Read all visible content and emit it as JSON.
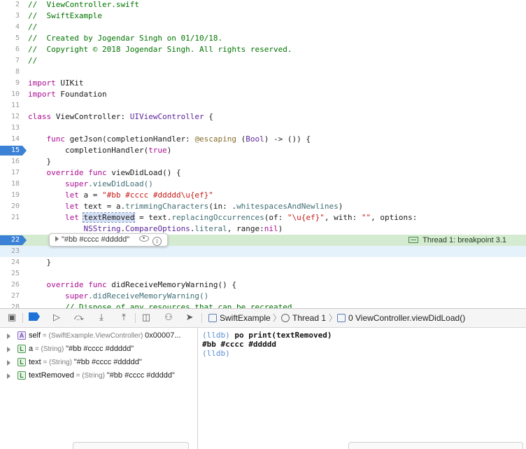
{
  "editor": {
    "lines": [
      {
        "num": "2",
        "segments": [
          {
            "t": "//  ViewController.swift",
            "c": "comment"
          }
        ]
      },
      {
        "num": "3",
        "segments": [
          {
            "t": "//  SwiftExample",
            "c": "comment"
          }
        ]
      },
      {
        "num": "4",
        "segments": [
          {
            "t": "//",
            "c": "comment"
          }
        ]
      },
      {
        "num": "5",
        "segments": [
          {
            "t": "//  Created by Jogendar Singh on 01/10/18.",
            "c": "comment"
          }
        ]
      },
      {
        "num": "6",
        "segments": [
          {
            "t": "//  Copyright © 2018 Jogendar Singh. All rights reserved.",
            "c": "comment"
          }
        ]
      },
      {
        "num": "7",
        "segments": [
          {
            "t": "//",
            "c": "comment"
          }
        ]
      },
      {
        "num": "8",
        "segments": []
      },
      {
        "num": "9",
        "segments": [
          {
            "t": "import",
            "c": "keyword"
          },
          {
            "t": " UIKit",
            "c": "plain"
          }
        ]
      },
      {
        "num": "10",
        "segments": [
          {
            "t": "import",
            "c": "keyword"
          },
          {
            "t": " Foundation",
            "c": "plain"
          }
        ]
      },
      {
        "num": "11",
        "segments": []
      },
      {
        "num": "12",
        "segments": [
          {
            "t": "class",
            "c": "keyword"
          },
          {
            "t": " ViewController: ",
            "c": "plain"
          },
          {
            "t": "UIViewController",
            "c": "type"
          },
          {
            "t": " {",
            "c": "plain"
          }
        ]
      },
      {
        "num": "13",
        "segments": []
      },
      {
        "num": "14",
        "segments": [
          {
            "t": "    ",
            "c": "plain"
          },
          {
            "t": "func",
            "c": "keyword"
          },
          {
            "t": " getJson(completionHandler: ",
            "c": "plain"
          },
          {
            "t": "@escaping",
            "c": "attr"
          },
          {
            "t": " (",
            "c": "plain"
          },
          {
            "t": "Bool",
            "c": "type"
          },
          {
            "t": ") -> ()) {",
            "c": "plain"
          }
        ]
      },
      {
        "num": "15",
        "breakpoint": true,
        "segments": [
          {
            "t": "        completionHandler(",
            "c": "plain"
          },
          {
            "t": "true",
            "c": "keyword"
          },
          {
            "t": ")",
            "c": "plain"
          }
        ]
      },
      {
        "num": "16",
        "segments": [
          {
            "t": "    }",
            "c": "plain"
          }
        ]
      },
      {
        "num": "17",
        "segments": [
          {
            "t": "    ",
            "c": "plain"
          },
          {
            "t": "override",
            "c": "keyword"
          },
          {
            "t": " ",
            "c": "plain"
          },
          {
            "t": "func",
            "c": "keyword"
          },
          {
            "t": " viewDidLoad() {",
            "c": "plain"
          }
        ]
      },
      {
        "num": "18",
        "segments": [
          {
            "t": "        ",
            "c": "plain"
          },
          {
            "t": "super",
            "c": "keyword"
          },
          {
            "t": ".viewDidLoad()",
            "c": "var"
          }
        ]
      },
      {
        "num": "19",
        "segments": [
          {
            "t": "        ",
            "c": "plain"
          },
          {
            "t": "let",
            "c": "keyword"
          },
          {
            "t": " a = ",
            "c": "plain"
          },
          {
            "t": "\"#bb #cccc #ddddd\\u{ef}\"",
            "c": "string"
          }
        ]
      },
      {
        "num": "20",
        "segments": [
          {
            "t": "        ",
            "c": "plain"
          },
          {
            "t": "let",
            "c": "keyword"
          },
          {
            "t": " text = a.",
            "c": "plain"
          },
          {
            "t": "trimmingCharacters",
            "c": "var"
          },
          {
            "t": "(in: .",
            "c": "plain"
          },
          {
            "t": "whitespacesAndNewlines",
            "c": "var"
          },
          {
            "t": ")",
            "c": "plain"
          }
        ]
      },
      {
        "num": "21",
        "segments": [
          {
            "t": "        ",
            "c": "plain"
          },
          {
            "t": "let",
            "c": "keyword"
          },
          {
            "t": " ",
            "c": "plain"
          },
          {
            "t": "textRemoved",
            "c": "highlight"
          },
          {
            "t": " = text.",
            "c": "plain"
          },
          {
            "t": "replacingOccurrences",
            "c": "var"
          },
          {
            "t": "(of: ",
            "c": "plain"
          },
          {
            "t": "\"\\u{ef}\"",
            "c": "string"
          },
          {
            "t": ", with: ",
            "c": "plain"
          },
          {
            "t": "\"\"",
            "c": "string"
          },
          {
            "t": ", options:",
            "c": "plain"
          }
        ]
      },
      {
        "num": "",
        "segments": [
          {
            "t": "            ",
            "c": "plain"
          },
          {
            "t": "NSString",
            "c": "type"
          },
          {
            "t": ".",
            "c": "plain"
          },
          {
            "t": "CompareOptions",
            "c": "type"
          },
          {
            "t": ".",
            "c": "plain"
          },
          {
            "t": "literal",
            "c": "var"
          },
          {
            "t": ", range:",
            "c": "plain"
          },
          {
            "t": "nil",
            "c": "keyword"
          },
          {
            "t": ")",
            "c": "plain"
          }
        ]
      },
      {
        "num": "22",
        "current": true,
        "segments": []
      },
      {
        "num": "23",
        "currentSub": true,
        "segments": []
      },
      {
        "num": "24",
        "segments": [
          {
            "t": "    }",
            "c": "plain"
          }
        ]
      },
      {
        "num": "25",
        "segments": []
      },
      {
        "num": "26",
        "segments": [
          {
            "t": "    ",
            "c": "plain"
          },
          {
            "t": "override",
            "c": "keyword"
          },
          {
            "t": " ",
            "c": "plain"
          },
          {
            "t": "func",
            "c": "keyword"
          },
          {
            "t": " didReceiveMemoryWarning() {",
            "c": "plain"
          }
        ]
      },
      {
        "num": "27",
        "segments": [
          {
            "t": "        ",
            "c": "plain"
          },
          {
            "t": "super",
            "c": "keyword"
          },
          {
            "t": ".didReceiveMemoryWarning()",
            "c": "var"
          }
        ]
      },
      {
        "num": "28",
        "segments": [
          {
            "t": "        // Dispose of any resources that can be recreated.",
            "c": "comment"
          }
        ]
      }
    ],
    "thread_label": "Thread 1: breakpoint 3.1",
    "popup_value": "\"#bb #cccc #ddddd\""
  },
  "debug_toolbar": {
    "icons": [
      "hide-debug-area-icon",
      "breakpoints-toggle-icon",
      "continue-icon",
      "step-over-icon",
      "step-into-icon",
      "step-out-icon",
      "view-hierarchy-icon",
      "memory-graph-icon",
      "simulate-location-icon"
    ],
    "breadcrumb": {
      "project": "SwiftExample",
      "thread": "Thread 1",
      "frame": "0 ViewController.viewDidLoad()"
    }
  },
  "variables": [
    {
      "badge": "A",
      "name": "self",
      "type": " = (SwiftExample.ViewController) ",
      "value": "0x00007..."
    },
    {
      "badge": "L",
      "name": "a",
      "type": " = (String) ",
      "value": "\"#bb #cccc #ddddd\""
    },
    {
      "badge": "L",
      "name": "text",
      "type": " = (String) ",
      "value": "\"#bb #cccc #ddddd\""
    },
    {
      "badge": "L",
      "name": "textRemoved",
      "type": " = (String) ",
      "value": "\"#bb #cccc #ddddd\""
    }
  ],
  "console": {
    "lines": [
      {
        "prompt": "(lldb)",
        "text": " po print(textRemoved)"
      },
      {
        "prompt": "",
        "text": "#bb #cccc #ddddd"
      },
      {
        "prompt": "(lldb)",
        "text": ""
      }
    ]
  },
  "colors": {
    "breakpoint": "#3b82d6",
    "current_line": "#d5ebd1",
    "comment": "#007400",
    "keyword": "#aa0d91",
    "string": "#c41a16"
  }
}
